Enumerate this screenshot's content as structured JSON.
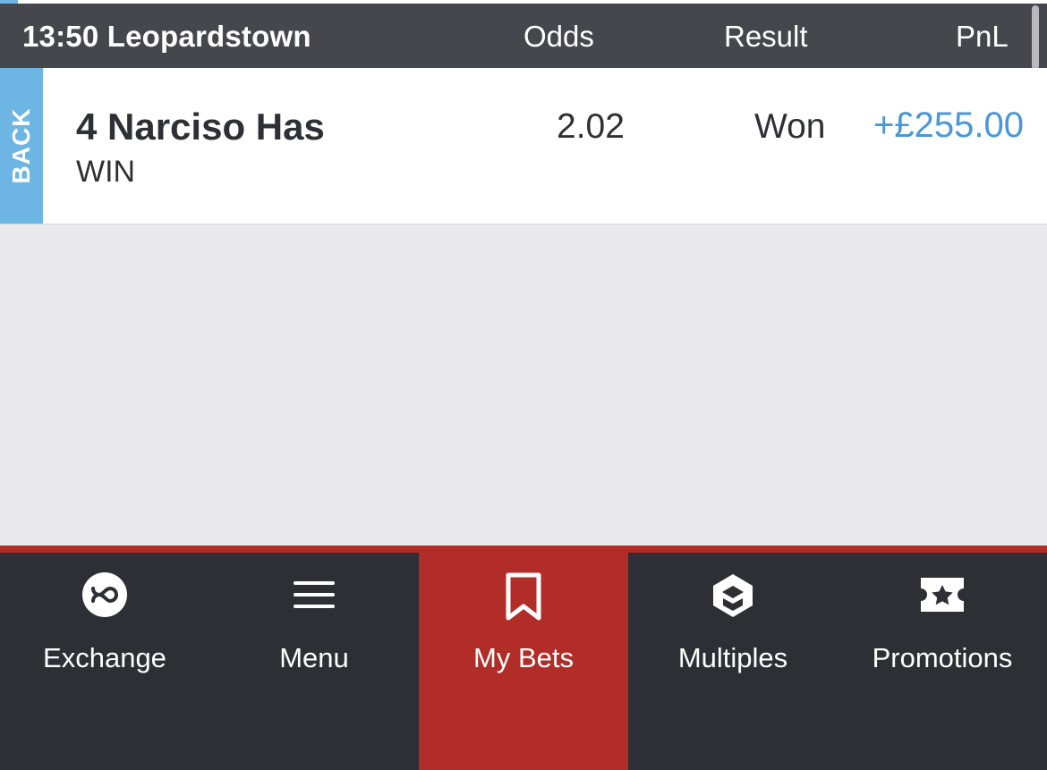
{
  "header": {
    "title": "13:50 Leopardstown",
    "columns": {
      "odds": "Odds",
      "result": "Result",
      "pnl": "PnL"
    }
  },
  "bets": [
    {
      "side": "BACK",
      "runner": "4 Narciso Has",
      "market": "WIN",
      "odds": "2.02",
      "result": "Won",
      "pnl": "+£255.00"
    }
  ],
  "colors": {
    "header_bg": "#46474c",
    "back_tag": "#6db6e4",
    "pnl_positive": "#4a97d8",
    "nav_bg": "#2d2f35",
    "nav_active": "#b22d27"
  },
  "bottom_nav": {
    "items": [
      {
        "label": "Exchange",
        "icon": "exchange-infinity-icon",
        "active": false
      },
      {
        "label": "Menu",
        "icon": "hamburger-menu-icon",
        "active": false
      },
      {
        "label": "My Bets",
        "icon": "bookmark-icon",
        "active": true
      },
      {
        "label": "Multiples",
        "icon": "multiples-icon",
        "active": false
      },
      {
        "label": "Promotions",
        "icon": "ticket-star-icon",
        "active": false
      }
    ]
  }
}
